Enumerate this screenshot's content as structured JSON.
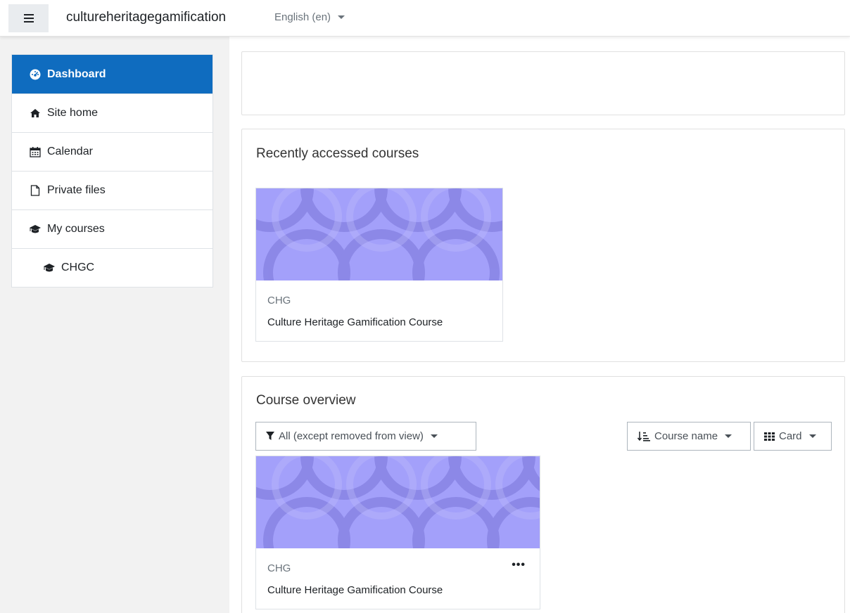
{
  "navbar": {
    "site_name": "cultureheritagegamification",
    "language": "English (en)"
  },
  "drawer": {
    "items": [
      {
        "label": "Dashboard",
        "icon": "tachometer-icon"
      },
      {
        "label": "Site home",
        "icon": "home-icon"
      },
      {
        "label": "Calendar",
        "icon": "calendar-icon"
      },
      {
        "label": "Private files",
        "icon": "file-icon"
      },
      {
        "label": "My courses",
        "icon": "graduation-cap-icon"
      },
      {
        "label": "CHGC",
        "icon": "graduation-cap-icon"
      }
    ]
  },
  "recent": {
    "title": "Recently accessed courses",
    "course": {
      "short_name": "CHG",
      "full_name": "Culture Heritage Gamification Course"
    }
  },
  "overview": {
    "title": "Course overview",
    "filter_label": "All (except removed from view)",
    "sort_label": "Course name",
    "view_label": "Card",
    "course": {
      "short_name": "CHG",
      "full_name": "Culture Heritage Gamification Course"
    }
  },
  "colors": {
    "accent": "#0f6cbf",
    "card_pattern": "#a3a0fa"
  }
}
